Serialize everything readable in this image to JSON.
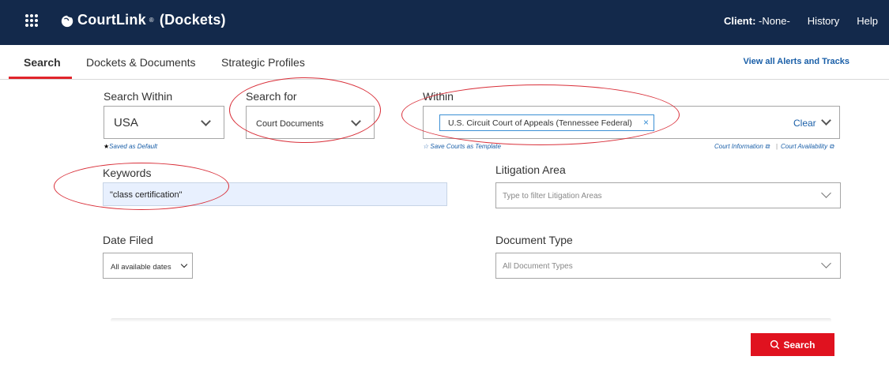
{
  "header": {
    "app_name": "CourtLink",
    "app_mark": "®",
    "app_section": "(Dockets)",
    "client_label": "Client:",
    "client_value": "-None-",
    "history": "History",
    "help": "Help",
    "icons": {
      "menu": "grid-icon",
      "logo": "lexisnexis-logo-icon"
    }
  },
  "tabs": [
    {
      "label": "Search",
      "active": true
    },
    {
      "label": "Dockets & Documents",
      "active": false
    },
    {
      "label": "Strategic Profiles",
      "active": false
    }
  ],
  "alerts_link": "View all Alerts and Tracks",
  "search_within": {
    "label": "Search Within",
    "value": "USA",
    "note_star": "★",
    "note": "Saved as Default"
  },
  "search_for": {
    "label": "Search for",
    "value": "Court Documents"
  },
  "within": {
    "label": "Within",
    "chip": "U.S. Circuit Court of Appeals (Tennessee Federal)",
    "chip_remove": "×",
    "clear": "Clear",
    "save_template": "☆ Save Courts as Template",
    "court_information": "Court Information",
    "court_availability": "Court Availability",
    "separator": "|"
  },
  "keywords": {
    "label": "Keywords",
    "value": "\"class certification\""
  },
  "litigation_area": {
    "label": "Litigation Area",
    "placeholder": "Type to filter Litigation Areas"
  },
  "date_filed": {
    "label": "Date Filed",
    "value": "All available dates"
  },
  "document_type": {
    "label": "Document Type",
    "placeholder": "All Document Types"
  },
  "search_button": "Search",
  "colors": {
    "header_bg": "#13294b",
    "accent_red": "#e1242b",
    "link_blue": "#1a5fa8",
    "annotation_red": "#d9303a"
  }
}
